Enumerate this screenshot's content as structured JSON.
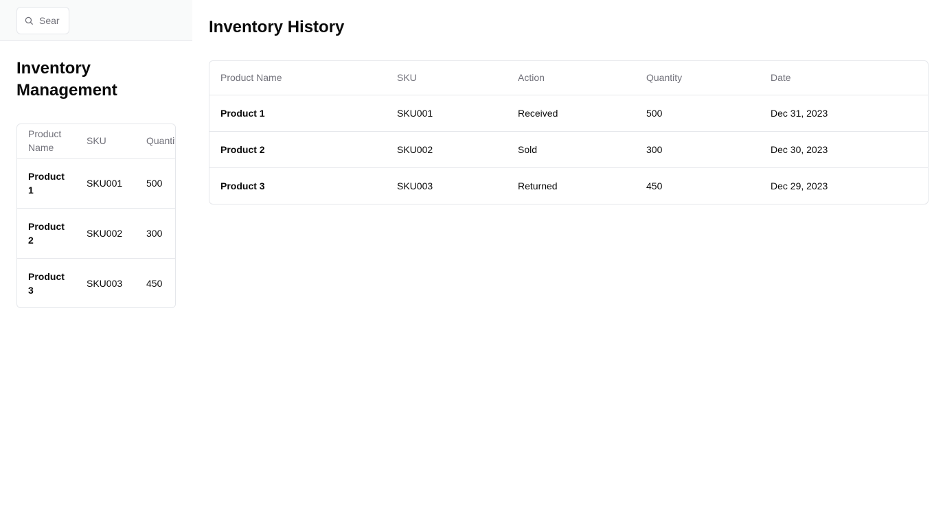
{
  "search": {
    "placeholder": "Search",
    "icon": "search-icon"
  },
  "sidebar": {
    "title": "Inventory Management",
    "table": {
      "headers": [
        "Product Name",
        "SKU",
        "Quantity"
      ],
      "rows": [
        {
          "name": "Product 1",
          "sku": "SKU001",
          "quantity": "500"
        },
        {
          "name": "Product 2",
          "sku": "SKU002",
          "quantity": "300"
        },
        {
          "name": "Product 3",
          "sku": "SKU003",
          "quantity": "450"
        }
      ]
    }
  },
  "main": {
    "title": "Inventory History",
    "table": {
      "headers": [
        "Product Name",
        "SKU",
        "Action",
        "Quantity",
        "Date"
      ],
      "rows": [
        {
          "name": "Product 1",
          "sku": "SKU001",
          "action": "Received",
          "quantity": "500",
          "date": "Dec 31, 2023"
        },
        {
          "name": "Product 2",
          "sku": "SKU002",
          "action": "Sold",
          "quantity": "300",
          "date": "Dec 30, 2023"
        },
        {
          "name": "Product 3",
          "sku": "SKU003",
          "action": "Returned",
          "quantity": "450",
          "date": "Dec 29, 2023"
        }
      ]
    }
  }
}
